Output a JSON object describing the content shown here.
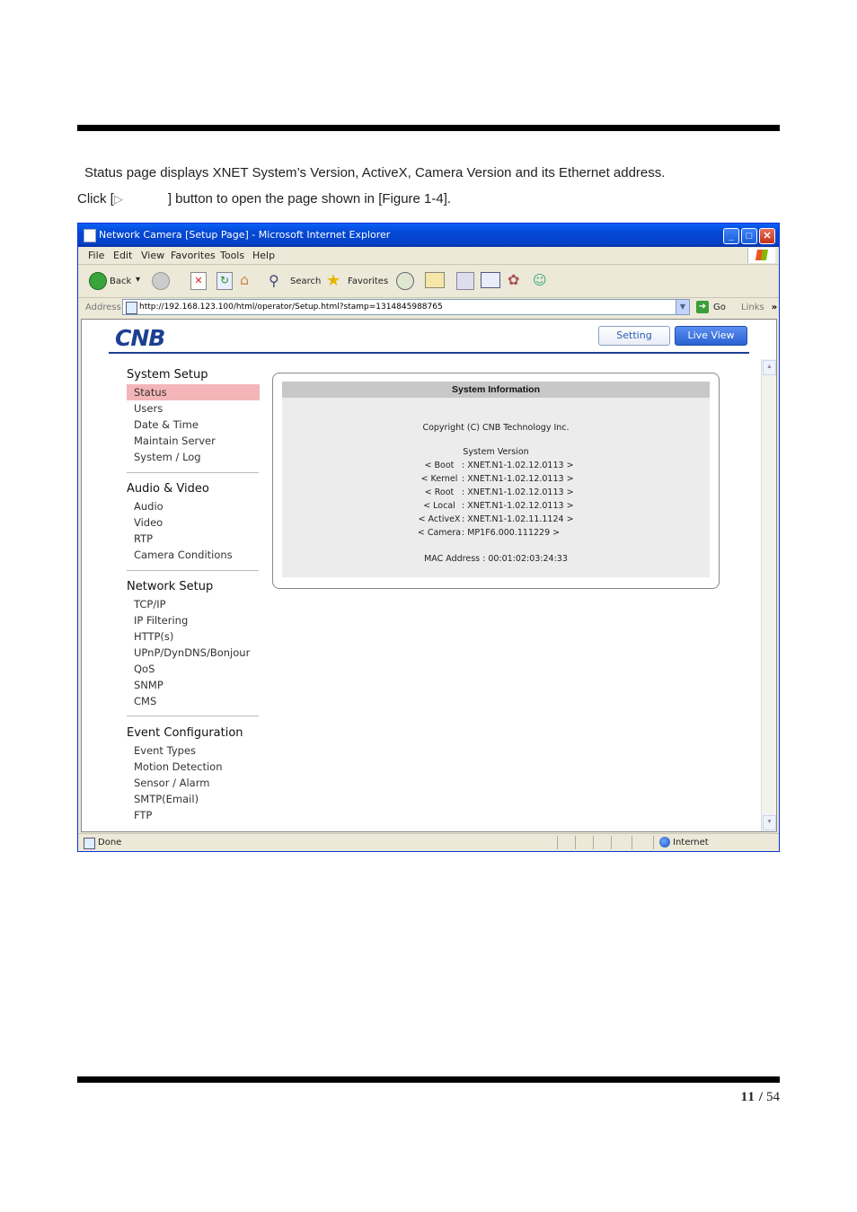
{
  "document": {
    "intro_line": "Status page displays XNET System’s Version, ActiveX, Camera Version and its Ethernet address.",
    "click_prefix": "Click [",
    "click_icon": "▷",
    "click_suffix": "] button to open the page shown in [Figure 1-4].",
    "page_current": "11",
    "page_separator": "/",
    "page_total": "54"
  },
  "window": {
    "title": "Network Camera [Setup Page] - Microsoft Internet Explorer",
    "menu": [
      "File",
      "Edit",
      "View",
      "Favorites",
      "Tools",
      "Help"
    ],
    "toolbar": {
      "back": "Back",
      "search": "Search",
      "favorites": "Favorites"
    },
    "address_label": "Address",
    "url": "http://192.168.123.100/html/operator/Setup.html?stamp=1314845988765",
    "go": "Go",
    "links": "Links",
    "links_more": "»",
    "status_done": "Done",
    "status_zone": "Internet"
  },
  "app": {
    "logo": "CNB",
    "tab_setting": "Setting",
    "tab_live": "Live View",
    "nav": {
      "system_setup": {
        "title": "System Setup",
        "items": [
          "Status",
          "Users",
          "Date & Time",
          "Maintain Server",
          "System / Log"
        ]
      },
      "audio_video": {
        "title": "Audio & Video",
        "items": [
          "Audio",
          "Video",
          "RTP",
          "Camera Conditions"
        ]
      },
      "network_setup": {
        "title": "Network Setup",
        "items": [
          "TCP/IP",
          "IP Filtering",
          "HTTP(s)",
          "UPnP/DynDNS/Bonjour",
          "QoS",
          "SNMP",
          "CMS"
        ]
      },
      "event_config": {
        "title": "Event Configuration",
        "items": [
          "Event Types",
          "Motion Detection",
          "Sensor / Alarm",
          "SMTP(Email)",
          "FTP"
        ]
      }
    },
    "sysinfo": {
      "header": "System Information",
      "copyright": "Copyright (C) CNB Technology Inc.",
      "version_label": "System Version",
      "rows": [
        {
          "key": "< Boot",
          "value": ": XNET.N1-1.02.12.0113 >"
        },
        {
          "key": "< Kernel",
          "value": ": XNET.N1-1.02.12.0113 >"
        },
        {
          "key": "< Root",
          "value": ": XNET.N1-1.02.12.0113 >"
        },
        {
          "key": "< Local",
          "value": ": XNET.N1-1.02.12.0113 >"
        },
        {
          "key": "< ActiveX",
          "value": ": XNET.N1-1.02.11.1124 >"
        },
        {
          "key": "< Camera",
          "value": ": MP1F6.000.111229 >"
        }
      ],
      "mac": "MAC Address : 00:01:02:03:24:33"
    }
  }
}
